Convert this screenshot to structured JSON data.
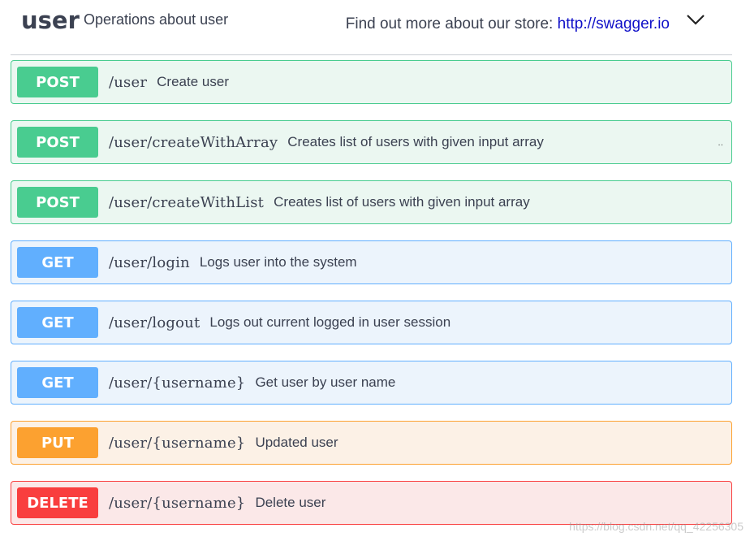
{
  "header": {
    "tag": "user",
    "description": "Operations about user",
    "external_prefix": "Find out more about our store:",
    "external_link": "http://swagger.io",
    "chevron_icon": "chevron-down-icon"
  },
  "operations": [
    {
      "method": "POST",
      "path": "/user",
      "summary": "Create user"
    },
    {
      "method": "POST",
      "path": "/user/createWithArray",
      "summary": "Creates list of users with given input array"
    },
    {
      "method": "POST",
      "path": "/user/createWithList",
      "summary": "Creates list of users with given input array"
    },
    {
      "method": "GET",
      "path": "/user/login",
      "summary": "Logs user into the system"
    },
    {
      "method": "GET",
      "path": "/user/logout",
      "summary": "Logs out current logged in user session"
    },
    {
      "method": "GET",
      "path": "/user/{username}",
      "summary": "Get user by user name"
    },
    {
      "method": "PUT",
      "path": "/user/{username}",
      "summary": "Updated user"
    },
    {
      "method": "DELETE",
      "path": "/user/{username}",
      "summary": "Delete user"
    }
  ],
  "colors": {
    "post": "#49cc90",
    "get": "#61affe",
    "put": "#fca130",
    "delete": "#f93e3e"
  },
  "watermark": "https://blog.csdn.net/qq_42256305"
}
